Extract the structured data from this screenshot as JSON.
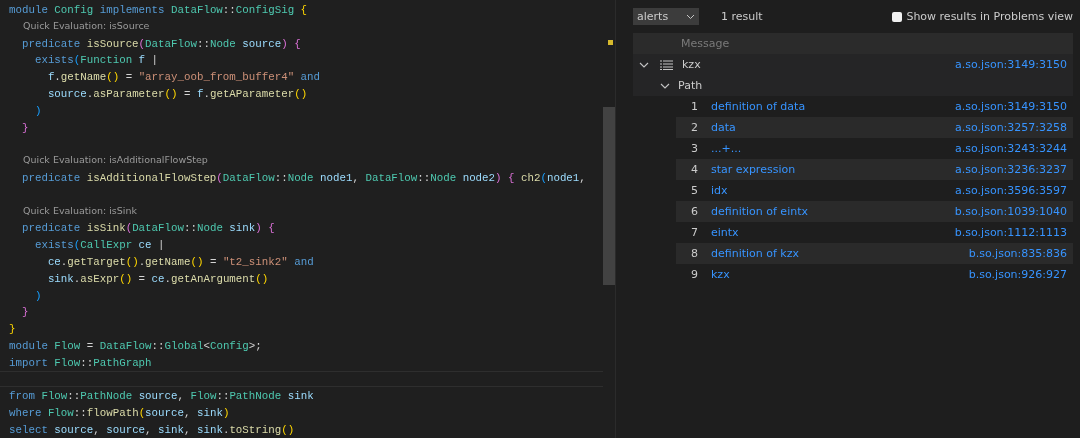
{
  "editor": {
    "lines": [
      {
        "kind": "code",
        "tokens": [
          {
            "kind": "kw",
            "text": "module "
          },
          {
            "kind": "type",
            "text": "Config "
          },
          {
            "kind": "kw",
            "text": "implements "
          },
          {
            "kind": "type",
            "text": "DataFlow"
          },
          {
            "kind": "p",
            "text": "::"
          },
          {
            "kind": "type",
            "text": "ConfigSig "
          },
          {
            "kind": "b1",
            "text": "{"
          }
        ]
      },
      {
        "kind": "lens",
        "text": "Quick Evaluation: isSource"
      },
      {
        "kind": "code",
        "tokens": [
          {
            "kind": "kw",
            "text": "  predicate "
          },
          {
            "kind": "fn",
            "text": "isSource"
          },
          {
            "kind": "b2",
            "text": "("
          },
          {
            "kind": "type",
            "text": "DataFlow"
          },
          {
            "kind": "p",
            "text": "::"
          },
          {
            "kind": "type",
            "text": "Node "
          },
          {
            "kind": "var",
            "text": "source"
          },
          {
            "kind": "b2",
            "text": ") {"
          }
        ]
      },
      {
        "kind": "code",
        "tokens": [
          {
            "kind": "kw",
            "text": "    exists"
          },
          {
            "kind": "b3",
            "text": "("
          },
          {
            "kind": "type",
            "text": "Function "
          },
          {
            "kind": "var",
            "text": "f "
          },
          {
            "kind": "p",
            "text": "|"
          }
        ]
      },
      {
        "kind": "code",
        "tokens": [
          {
            "kind": "var",
            "text": "      f"
          },
          {
            "kind": "p",
            "text": "."
          },
          {
            "kind": "fn",
            "text": "getName"
          },
          {
            "kind": "b1",
            "text": "()"
          },
          {
            "kind": "p",
            "text": " = "
          },
          {
            "kind": "str",
            "text": "\"array_oob_from_buffer4\""
          },
          {
            "kind": "kw",
            "text": " and"
          }
        ]
      },
      {
        "kind": "code",
        "tokens": [
          {
            "kind": "var",
            "text": "      source"
          },
          {
            "kind": "p",
            "text": "."
          },
          {
            "kind": "fn",
            "text": "asParameter"
          },
          {
            "kind": "b1",
            "text": "()"
          },
          {
            "kind": "p",
            "text": " = "
          },
          {
            "kind": "var",
            "text": "f"
          },
          {
            "kind": "p",
            "text": "."
          },
          {
            "kind": "fn",
            "text": "getAParameter"
          },
          {
            "kind": "b1",
            "text": "()"
          }
        ]
      },
      {
        "kind": "code",
        "tokens": [
          {
            "kind": "b3",
            "text": "    )"
          }
        ]
      },
      {
        "kind": "code",
        "tokens": [
          {
            "kind": "b2",
            "text": "  }"
          }
        ]
      },
      {
        "kind": "empty"
      },
      {
        "kind": "lens",
        "text": "Quick Evaluation: isAdditionalFlowStep"
      },
      {
        "kind": "code",
        "tokens": [
          {
            "kind": "kw",
            "text": "  predicate "
          },
          {
            "kind": "fn",
            "text": "isAdditionalFlowStep"
          },
          {
            "kind": "b2",
            "text": "("
          },
          {
            "kind": "type",
            "text": "DataFlow"
          },
          {
            "kind": "p",
            "text": "::"
          },
          {
            "kind": "type",
            "text": "Node "
          },
          {
            "kind": "var",
            "text": "node1"
          },
          {
            "kind": "p",
            "text": ", "
          },
          {
            "kind": "type",
            "text": "DataFlow"
          },
          {
            "kind": "p",
            "text": "::"
          },
          {
            "kind": "type",
            "text": "Node "
          },
          {
            "kind": "var",
            "text": "node2"
          },
          {
            "kind": "b2",
            "text": ") {"
          },
          {
            "kind": "fn",
            "text": " ch2"
          },
          {
            "kind": "b3",
            "text": "("
          },
          {
            "kind": "var",
            "text": "node1"
          },
          {
            "kind": "p",
            "text": ","
          }
        ]
      },
      {
        "kind": "empty"
      },
      {
        "kind": "lens",
        "text": "Quick Evaluation: isSink"
      },
      {
        "kind": "code",
        "tokens": [
          {
            "kind": "kw",
            "text": "  predicate "
          },
          {
            "kind": "fn",
            "text": "isSink"
          },
          {
            "kind": "b2",
            "text": "("
          },
          {
            "kind": "type",
            "text": "DataFlow"
          },
          {
            "kind": "p",
            "text": "::"
          },
          {
            "kind": "type",
            "text": "Node "
          },
          {
            "kind": "var",
            "text": "sink"
          },
          {
            "kind": "b2",
            "text": ") {"
          }
        ]
      },
      {
        "kind": "code",
        "tokens": [
          {
            "kind": "kw",
            "text": "    exists"
          },
          {
            "kind": "b3",
            "text": "("
          },
          {
            "kind": "type",
            "text": "CallExpr "
          },
          {
            "kind": "var",
            "text": "ce "
          },
          {
            "kind": "p",
            "text": "|"
          }
        ]
      },
      {
        "kind": "code",
        "tokens": [
          {
            "kind": "var",
            "text": "      ce"
          },
          {
            "kind": "p",
            "text": "."
          },
          {
            "kind": "fn",
            "text": "getTarget"
          },
          {
            "kind": "b1",
            "text": "()"
          },
          {
            "kind": "p",
            "text": "."
          },
          {
            "kind": "fn",
            "text": "getName"
          },
          {
            "kind": "b1",
            "text": "()"
          },
          {
            "kind": "p",
            "text": " = "
          },
          {
            "kind": "str",
            "text": "\"t2_sink2\""
          },
          {
            "kind": "kw",
            "text": " and"
          }
        ]
      },
      {
        "kind": "code",
        "tokens": [
          {
            "kind": "var",
            "text": "      sink"
          },
          {
            "kind": "p",
            "text": "."
          },
          {
            "kind": "fn",
            "text": "asExpr"
          },
          {
            "kind": "b1",
            "text": "()"
          },
          {
            "kind": "p",
            "text": " = "
          },
          {
            "kind": "var",
            "text": "ce"
          },
          {
            "kind": "p",
            "text": "."
          },
          {
            "kind": "fn",
            "text": "getAnArgument"
          },
          {
            "kind": "b1",
            "text": "()"
          }
        ]
      },
      {
        "kind": "code",
        "tokens": [
          {
            "kind": "b3",
            "text": "    )"
          }
        ]
      },
      {
        "kind": "code",
        "tokens": [
          {
            "kind": "b2",
            "text": "  }"
          }
        ]
      },
      {
        "kind": "code",
        "tokens": [
          {
            "kind": "b1",
            "text": "}"
          }
        ]
      },
      {
        "kind": "code",
        "tokens": [
          {
            "kind": "kw",
            "text": "module "
          },
          {
            "kind": "type",
            "text": "Flow"
          },
          {
            "kind": "p",
            "text": " = "
          },
          {
            "kind": "type",
            "text": "DataFlow"
          },
          {
            "kind": "p",
            "text": "::"
          },
          {
            "kind": "type",
            "text": "Global"
          },
          {
            "kind": "p",
            "text": "<"
          },
          {
            "kind": "type",
            "text": "Config"
          },
          {
            "kind": "p",
            "text": ">;"
          }
        ]
      },
      {
        "kind": "code",
        "tokens": [
          {
            "kind": "kw",
            "text": "import "
          },
          {
            "kind": "type",
            "text": "Flow"
          },
          {
            "kind": "p",
            "text": "::"
          },
          {
            "kind": "type",
            "text": "PathGraph"
          }
        ]
      },
      {
        "kind": "empty",
        "current": true
      },
      {
        "kind": "code",
        "tokens": [
          {
            "kind": "kw",
            "text": "from "
          },
          {
            "kind": "type",
            "text": "Flow"
          },
          {
            "kind": "p",
            "text": "::"
          },
          {
            "kind": "type",
            "text": "PathNode "
          },
          {
            "kind": "var",
            "text": "source"
          },
          {
            "kind": "p",
            "text": ", "
          },
          {
            "kind": "type",
            "text": "Flow"
          },
          {
            "kind": "p",
            "text": "::"
          },
          {
            "kind": "type",
            "text": "PathNode "
          },
          {
            "kind": "var",
            "text": "sink"
          }
        ]
      },
      {
        "kind": "code",
        "tokens": [
          {
            "kind": "kw",
            "text": "where "
          },
          {
            "kind": "type",
            "text": "Flow"
          },
          {
            "kind": "p",
            "text": "::"
          },
          {
            "kind": "fn",
            "text": "flowPath"
          },
          {
            "kind": "b1",
            "text": "("
          },
          {
            "kind": "var",
            "text": "source"
          },
          {
            "kind": "p",
            "text": ", "
          },
          {
            "kind": "var",
            "text": "sink"
          },
          {
            "kind": "b1",
            "text": ")"
          }
        ]
      },
      {
        "kind": "code",
        "tokens": [
          {
            "kind": "kw",
            "text": "select "
          },
          {
            "kind": "var",
            "text": "source"
          },
          {
            "kind": "p",
            "text": ", "
          },
          {
            "kind": "var",
            "text": "source"
          },
          {
            "kind": "p",
            "text": ", "
          },
          {
            "kind": "var",
            "text": "sink"
          },
          {
            "kind": "p",
            "text": ", "
          },
          {
            "kind": "var",
            "text": "sink"
          },
          {
            "kind": "p",
            "text": "."
          },
          {
            "kind": "fn",
            "text": "toString"
          },
          {
            "kind": "b1",
            "text": "()"
          }
        ]
      }
    ]
  },
  "results": {
    "result_set": "alerts",
    "count": "1 result",
    "problems_view": {
      "label": "Show results in Problems view",
      "checked": false
    },
    "table": {
      "header": "Message",
      "rows": [
        {
          "message": "kzx",
          "location": "a.so.json:3149:3150",
          "expanded": true,
          "children": [
            {
              "label": "Path",
              "expanded": true,
              "children": [
                {
                  "index": "1",
                  "text": "definition of data",
                  "location": "a.so.json:3149:3150"
                },
                {
                  "index": "2",
                  "text": "data",
                  "location": "a.so.json:3257:3258"
                },
                {
                  "index": "3",
                  "text": "...+...",
                  "location": "a.so.json:3243:3244"
                },
                {
                  "index": "4",
                  "text": "star expression",
                  "location": "a.so.json:3236:3237"
                },
                {
                  "index": "5",
                  "text": "idx",
                  "location": "a.so.json:3596:3597"
                },
                {
                  "index": "6",
                  "text": "definition of eintx",
                  "location": "b.so.json:1039:1040"
                },
                {
                  "index": "7",
                  "text": "eintx",
                  "location": "b.so.json:1112:1113"
                },
                {
                  "index": "8",
                  "text": "definition of kzx",
                  "location": "b.so.json:835:836"
                },
                {
                  "index": "9",
                  "text": "kzx",
                  "location": "b.so.json:926:927"
                }
              ]
            }
          ]
        }
      ]
    }
  }
}
